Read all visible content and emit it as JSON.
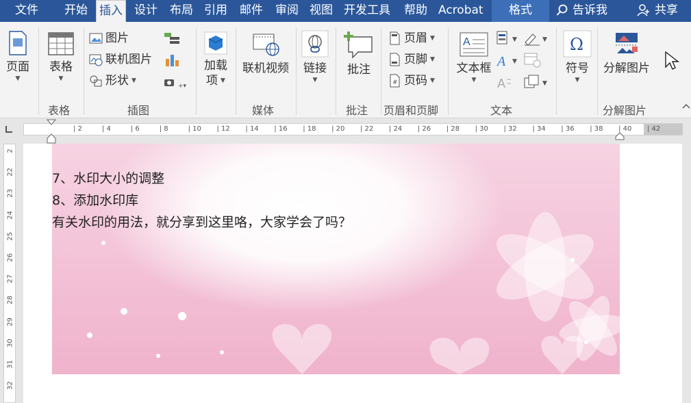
{
  "menu": {
    "tabs": [
      "文件",
      "开始",
      "插入",
      "设计",
      "布局",
      "引用",
      "邮件",
      "审阅",
      "视图",
      "开发工具",
      "帮助",
      "Acrobat",
      "格式"
    ],
    "active_tab": "插入",
    "tell_me": "告诉我",
    "share": "共享"
  },
  "ribbon": {
    "pages": {
      "label": "页面"
    },
    "tables": {
      "button": "表格",
      "group": "表格"
    },
    "illustrations": {
      "group": "插图",
      "picture": "图片",
      "online_picture": "联机图片",
      "shapes": "形状"
    },
    "addins": {
      "line1": "加载",
      "line2": "项"
    },
    "media": {
      "button": "联机视频",
      "group": "媒体"
    },
    "links": {
      "button": "链接"
    },
    "comments": {
      "button": "批注",
      "group": "批注"
    },
    "header_footer": {
      "header": "页眉",
      "footer": "页脚",
      "page_number": "页码",
      "group": "页眉和页脚"
    },
    "text": {
      "textbox": "文本框",
      "group": "文本"
    },
    "symbols": {
      "button": "符号"
    },
    "decompose": {
      "button": "分解图片",
      "group": "分解图片"
    }
  },
  "ruler": {
    "ticks": [
      "2",
      "4",
      "6",
      "8",
      "10",
      "12",
      "14",
      "16",
      "18",
      "20",
      "22",
      "24",
      "26",
      "28",
      "30",
      "32",
      "34",
      "36",
      "38",
      "40",
      "42"
    ]
  },
  "vruler": {
    "ticks": [
      "2",
      "22",
      "23",
      "24",
      "25",
      "26",
      "27",
      "28",
      "29",
      "30",
      "31",
      "32",
      "33"
    ]
  },
  "document": {
    "lines": [
      "7、水印大小的调整",
      "8、添加水印库",
      "有关水印的用法，就分享到这里咯，大家学会了吗？"
    ]
  },
  "colors": {
    "accent": "#2b579a",
    "banner_pink": "#f3c1d6"
  }
}
